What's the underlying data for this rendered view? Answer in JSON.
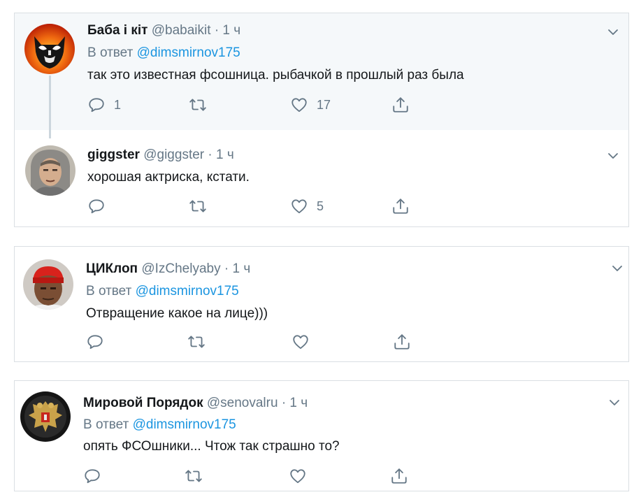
{
  "tweets": [
    {
      "name": "Баба і кіт",
      "handle": "@babaikit",
      "time": "· 1 ч",
      "reply_prefix": "В ответ",
      "reply_to": "@dimsmirnov175",
      "text": "так это известная фсошница. рыбачкой в прошлый раз была",
      "reply_count": "1",
      "retweet_count": "",
      "like_count": "17",
      "avatar": "masked-cat-fire-avatar"
    },
    {
      "name": "giggster",
      "handle": "@giggster",
      "time": "· 1 ч",
      "text": "хорошая актриска, кстати.",
      "reply_count": "",
      "retweet_count": "",
      "like_count": "5",
      "avatar": "hooded-man-avatar"
    },
    {
      "name": "ЦИКлоп",
      "handle": "@IzChelyaby",
      "time": "· 1 ч",
      "reply_prefix": "В ответ",
      "reply_to": "@dimsmirnov175",
      "text": "Отвращение какое на лице)))",
      "reply_count": "",
      "retweet_count": "",
      "like_count": "",
      "avatar": "man-red-bandana-avatar"
    },
    {
      "name": "Мировой Порядок",
      "handle": "@senovalru",
      "time": "· 1 ч",
      "reply_prefix": "В ответ",
      "reply_to": "@dimsmirnov175",
      "text": "опять ФСОшники... Чтож так  страшно то?",
      "reply_count": "",
      "retweet_count": "",
      "like_count": "",
      "avatar": "russian-coat-of-arms-avatar"
    }
  ],
  "colors": {
    "highlight_bg": "#f5f8fa",
    "border": "#dadfe3",
    "link": "#1b95e0",
    "secondary_text": "#657786",
    "thread_line": "#ccd6dd"
  },
  "icons": [
    "reply-icon",
    "retweet-icon",
    "like-icon",
    "share-icon",
    "chevron-down-icon"
  ]
}
